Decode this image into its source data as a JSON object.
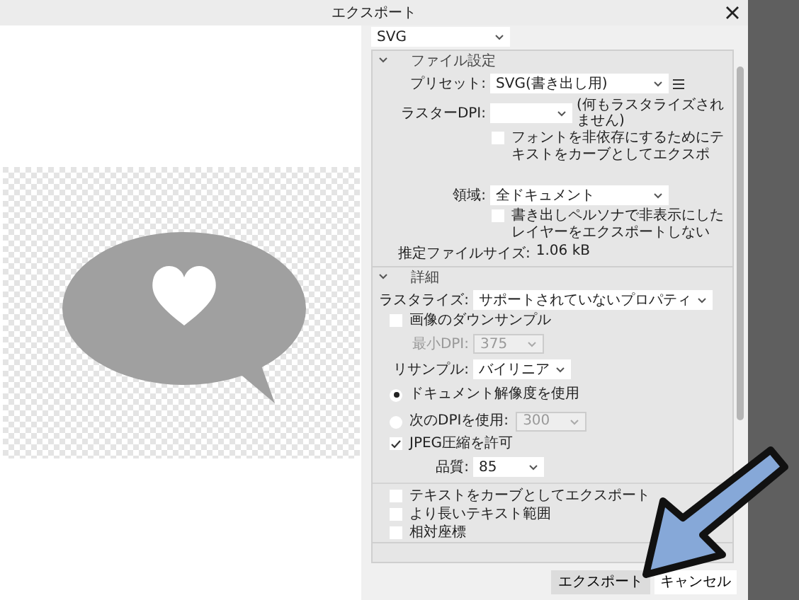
{
  "window": {
    "title": "エクスポート"
  },
  "format": {
    "value": "SVG"
  },
  "sections": [
    {
      "title": "ファイル設定",
      "expanded": true,
      "rows": [
        {
          "kind": "select",
          "label": "プリセット:",
          "value": "SVG(書き出し用)",
          "menu": true
        },
        {
          "kind": "select",
          "label": "ラスターDPI:",
          "value": "",
          "note": "(何もラスタライズされません)"
        },
        {
          "kind": "checkbox",
          "label": "フォントを非依存にするためにテキストをカーブとしてエクスポ",
          "checked": false
        },
        {
          "kind": "spacer"
        },
        {
          "kind": "select",
          "label": "領域:",
          "value": "全ドキュメント"
        },
        {
          "kind": "checkbox",
          "label": "書き出しペルソナで非表示にしたレイヤーをエクスポートしない",
          "checked": false
        },
        {
          "kind": "info",
          "label": "推定ファイルサイズ:",
          "value": "1.06 kB"
        }
      ]
    },
    {
      "title": "詳細",
      "expanded": true,
      "rows": [
        {
          "kind": "select",
          "label": "ラスタライズ:",
          "value": "サポートされていないプロパティ"
        },
        {
          "kind": "checkbox",
          "label": "画像のダウンサンプル",
          "checked": false
        },
        {
          "kind": "select",
          "label": "最小DPI:",
          "value": "375",
          "disabled": true
        },
        {
          "kind": "select",
          "label": "リサンプル:",
          "value": "バイリニア"
        },
        {
          "kind": "radio",
          "label": "ドキュメント解像度を使用",
          "selected": true
        },
        {
          "kind": "radio",
          "label": "次のDPIを使用:",
          "selected": false,
          "value": "300",
          "disabled": true
        },
        {
          "kind": "checkbox",
          "label": "JPEG圧縮を許可",
          "checked": true
        },
        {
          "kind": "select",
          "label": "品質:",
          "value": "85"
        },
        {
          "kind": "divider"
        },
        {
          "kind": "checkbox",
          "label": "テキストをカーブとしてエクスポート",
          "checked": false
        },
        {
          "kind": "checkbox",
          "label": "より長いテキスト範囲",
          "checked": false
        },
        {
          "kind": "checkbox",
          "label": "相対座標",
          "checked": false
        }
      ]
    }
  ],
  "buttons": [
    {
      "label": "エクスポート",
      "kind": "primary"
    },
    {
      "label": "キャンセル",
      "kind": "normal"
    }
  ]
}
